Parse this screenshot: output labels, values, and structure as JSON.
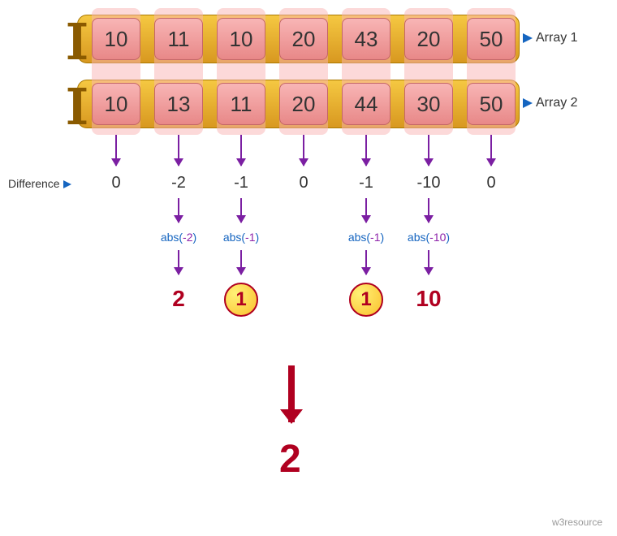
{
  "labels": {
    "array1": "Array 1",
    "array2": "Array 2",
    "difference": "Difference",
    "footer": "w3resource"
  },
  "arrays": {
    "a": [
      10,
      11,
      10,
      20,
      43,
      20,
      50
    ],
    "b": [
      10,
      13,
      11,
      20,
      44,
      30,
      50
    ]
  },
  "differences": [
    0,
    -2,
    -1,
    0,
    -1,
    -10,
    0
  ],
  "abs_steps": {
    "1": {
      "fn": "abs",
      "arg": "-2",
      "result": "2"
    },
    "2": {
      "fn": "abs",
      "arg": "-1",
      "result": "1",
      "circled": true
    },
    "4": {
      "fn": "abs",
      "arg": "-1",
      "result": "1",
      "circled": true
    },
    "5": {
      "fn": "abs",
      "arg": "-10",
      "result": "10"
    }
  },
  "final_result": "2"
}
